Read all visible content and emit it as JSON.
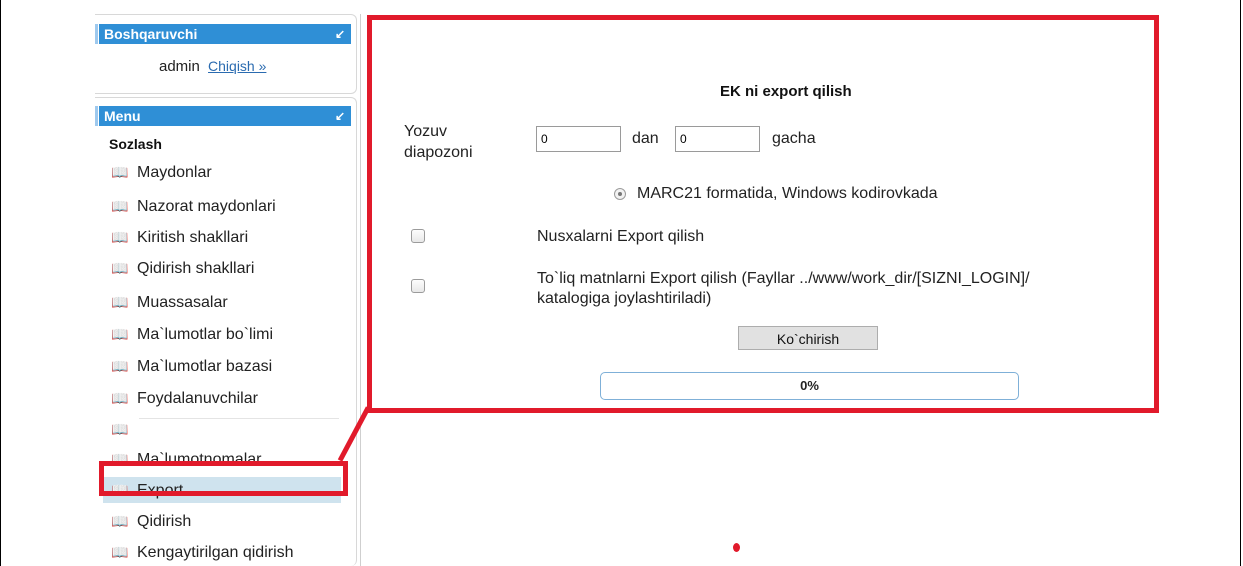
{
  "admin_panel": {
    "title": "Boshqaruvchi",
    "username": "admin",
    "logout_link": "Chiqish »"
  },
  "menu_panel": {
    "title": "Menu",
    "section": "Sozlash",
    "items": [
      {
        "label": "Maydonlar",
        "icon": "book-icon"
      },
      {
        "label": "Nazorat maydonlari",
        "icon": "book-icon"
      },
      {
        "label": "Kiritish shakllari",
        "icon": "book-icon"
      },
      {
        "label": "Qidirish shakllari",
        "icon": "book-icon"
      },
      {
        "label": "Muassasalar",
        "icon": "book-icon"
      },
      {
        "label": "Ma`lumotlar bo`limi",
        "icon": "book-icon"
      },
      {
        "label": "Ma`lumotlar bazasi",
        "icon": "book-icon"
      },
      {
        "label": "Foydalanuvchilar",
        "icon": "book-icon"
      },
      {
        "label": "",
        "icon": "book-icon"
      },
      {
        "label": "Ma`lumotnomalar",
        "icon": "book-icon"
      },
      {
        "label": "Export",
        "icon": "book-icon",
        "active": true
      },
      {
        "label": "Qidirish",
        "icon": "book-icon"
      },
      {
        "label": "Kengaytirilgan qidirish",
        "icon": "book-icon"
      }
    ]
  },
  "export_form": {
    "title": "EK ni export qilish",
    "range_label_line1": "Yozuv",
    "range_label_line2": "diapozoni",
    "from_value": "0",
    "from_suffix": "dan",
    "to_value": "0",
    "to_suffix": "gacha",
    "format_option": "MARC21 formatida, Windows kodirovkada",
    "format_selected": true,
    "copies_checkbox_label": "Nusxalarni Export qilish",
    "copies_checked": false,
    "fulltext_label_line1": "To`liq matnlarni Export qilish (Fayllar ../www/work_dir/[SIZNI_LOGIN]/",
    "fulltext_label_line2": "katalogiga joylashtiriladi)",
    "fulltext_checked": false,
    "submit_button": "Ko`chirish",
    "progress_text": "0%",
    "progress_value": 0
  },
  "colors": {
    "header_blue": "#2f8fd6",
    "highlight_red": "#e11a2b",
    "active_item_bg": "#cfe3ee"
  }
}
